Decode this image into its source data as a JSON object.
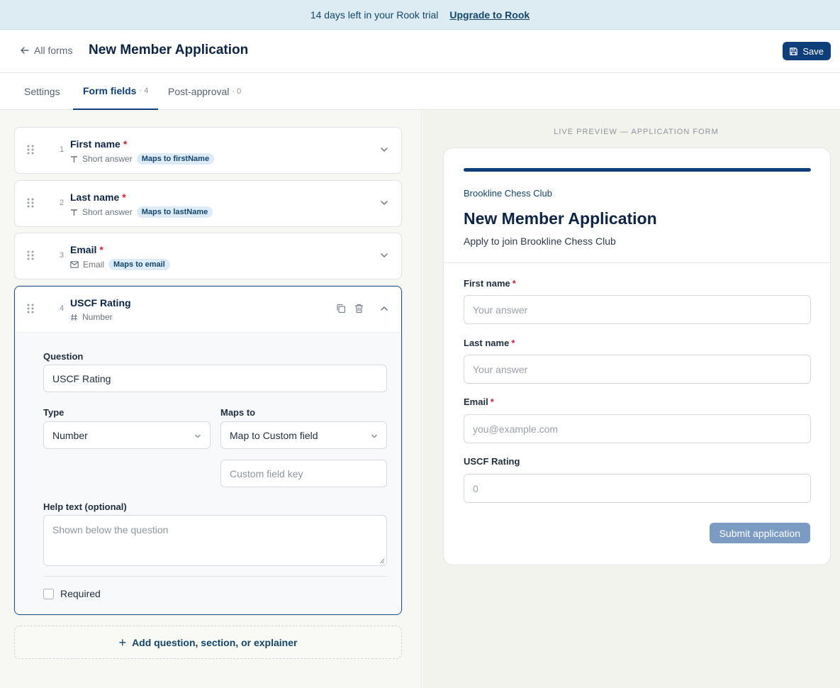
{
  "banner": {
    "text": "14 days left in your Rook trial",
    "link": "Upgrade to Rook"
  },
  "header": {
    "back_label": "All forms",
    "title": "New Member Application",
    "save_label": "Save"
  },
  "tabs": [
    {
      "label": "Settings",
      "count": ""
    },
    {
      "label": "Form fields",
      "count": "· 4"
    },
    {
      "label": "Post-approval",
      "count": "· 0"
    }
  ],
  "fields": [
    {
      "num": "1",
      "name": "First name",
      "required_mark": "*",
      "type": "Short answer",
      "badge": "Maps to firstName"
    },
    {
      "num": "2",
      "name": "Last name",
      "required_mark": "*",
      "type": "Short answer",
      "badge": "Maps to lastName"
    },
    {
      "num": "3",
      "name": "Email",
      "required_mark": "*",
      "type": "Email",
      "badge": "Maps to email"
    },
    {
      "num": "4",
      "name": "USCF Rating",
      "type": "Number"
    }
  ],
  "editor": {
    "question_label": "Question",
    "question_value": "USCF Rating",
    "type_label": "Type",
    "type_value": "Number",
    "maps_label": "Maps to",
    "maps_value": "Map to Custom field",
    "custom_key_placeholder": "Custom field key",
    "help_label": "Help text (optional)",
    "help_placeholder": "Shown below the question",
    "required_label": "Required"
  },
  "add_button": "Add question, section, or explainer",
  "preview": {
    "label": "LIVE PREVIEW — APPLICATION FORM",
    "org": "Brookline Chess Club",
    "title": "New Member Application",
    "subtitle": "Apply to join Brookline Chess Club",
    "fields": [
      {
        "label": "First name",
        "star": "*",
        "placeholder": "Your answer"
      },
      {
        "label": "Last name",
        "star": "*",
        "placeholder": "Your answer"
      },
      {
        "label": "Email",
        "star": "*",
        "placeholder": "you@example.com"
      },
      {
        "label": "USCF Rating",
        "star": "",
        "placeholder": "0"
      }
    ],
    "submit": "Submit application"
  },
  "colors": {
    "accent": "#0f3f7a",
    "required": "#c8243a",
    "banner_bg": "#dcecf2"
  }
}
